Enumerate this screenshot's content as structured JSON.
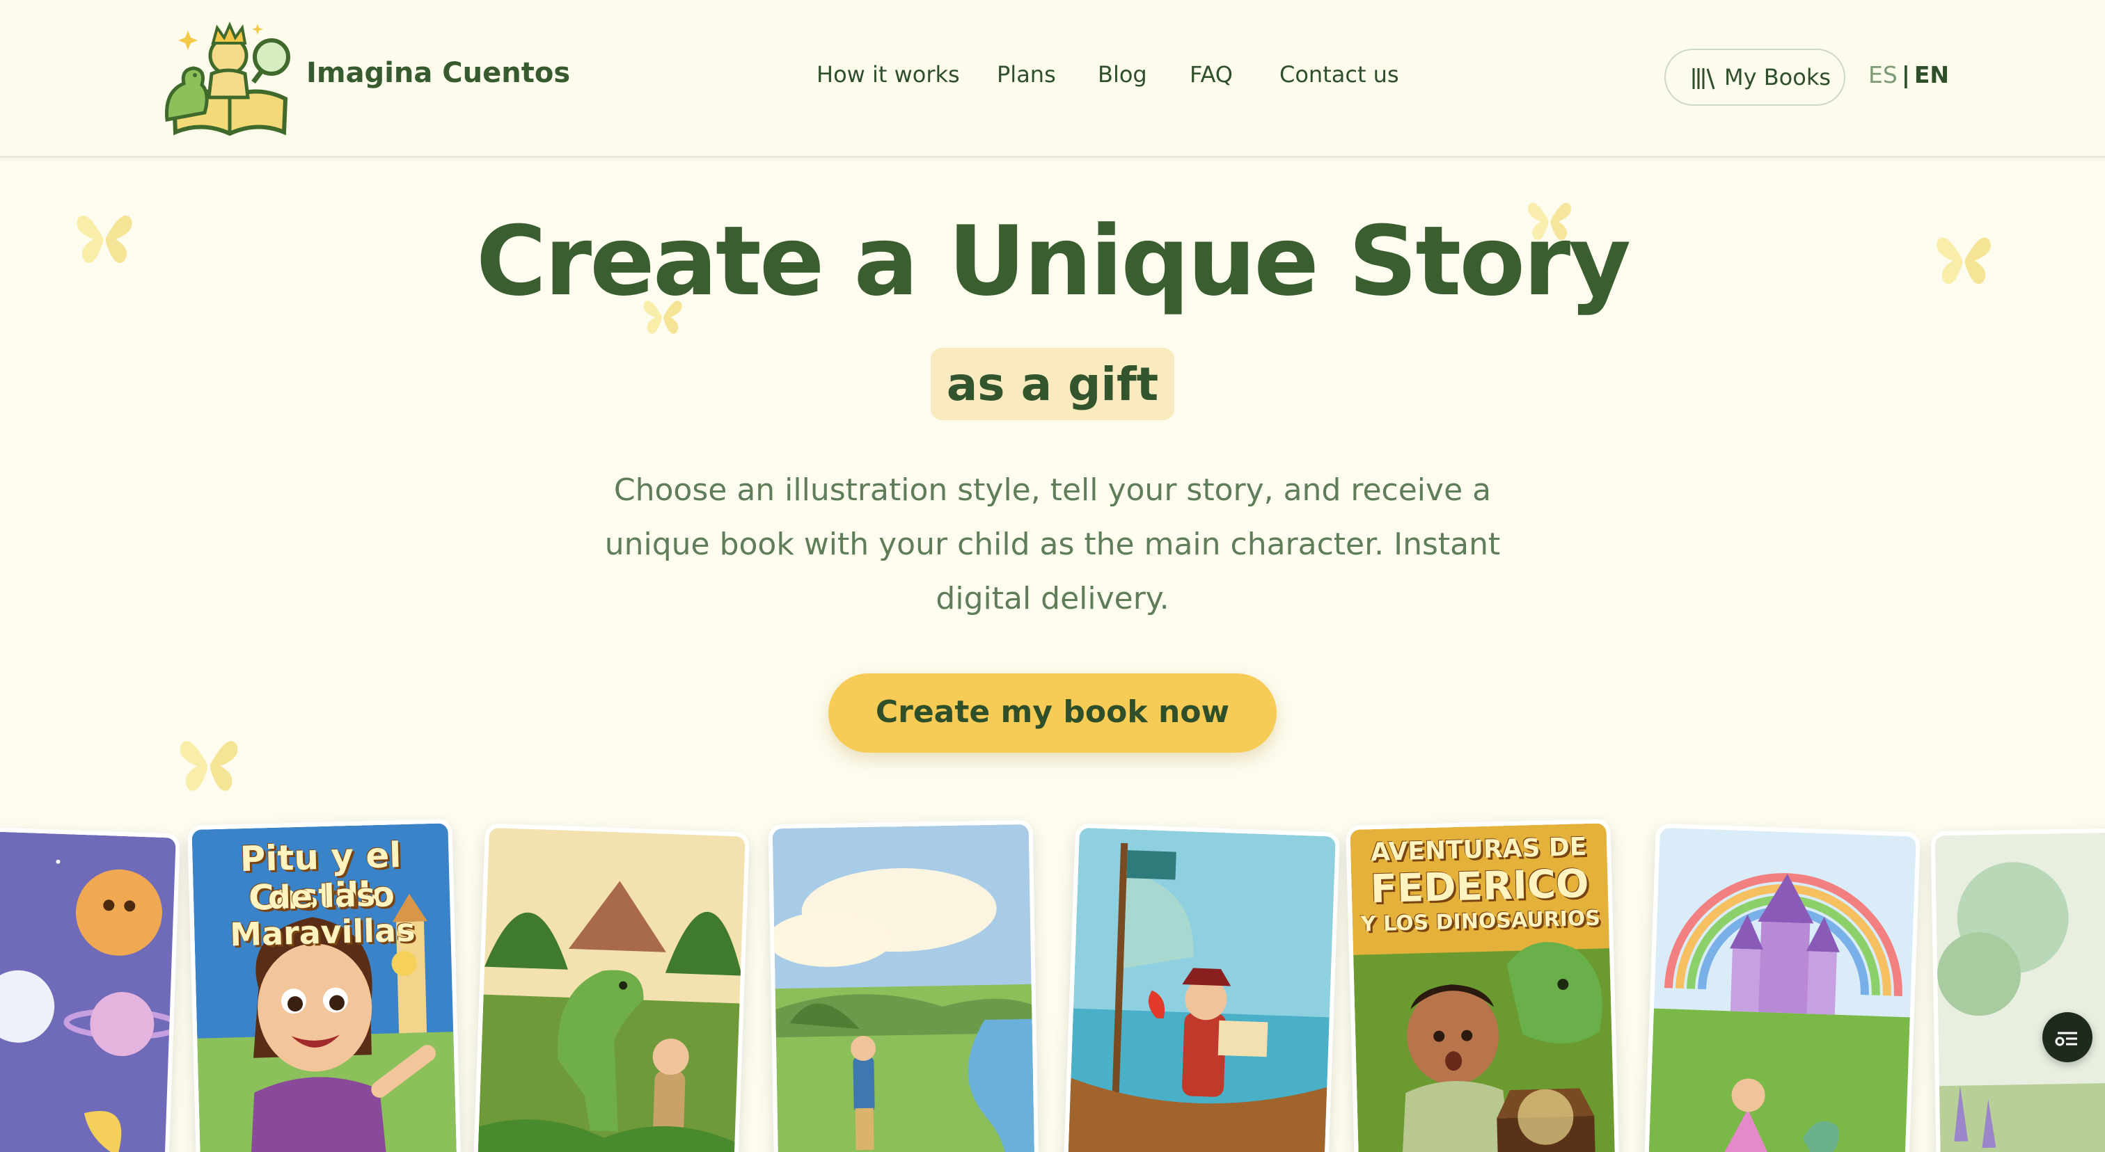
{
  "brand": {
    "name": "Imagina Cuentos",
    "logo": "dino-princess-book-logo"
  },
  "nav": {
    "items": [
      {
        "label": "How it works"
      },
      {
        "label": "Plans"
      },
      {
        "label": "Blog"
      },
      {
        "label": "FAQ"
      },
      {
        "label": "Contact us"
      }
    ]
  },
  "header": {
    "my_books_label": "My Books",
    "my_books_icon": "library-icon",
    "lang_es": "ES",
    "lang_sep": "|",
    "lang_en": "EN",
    "active_lang": "EN"
  },
  "hero": {
    "title": "Create a Unique Story",
    "highlight": "as a gift",
    "subtitle": "Choose an illustration style, tell your story, and receive a unique book with your child as the main character. Instant digital delivery.",
    "cta_label": "Create my book now"
  },
  "carousel": {
    "covers": [
      {
        "title": ""
      },
      {
        "title_line1": "Pitu y el Castillo",
        "title_line2": "de las Maravillas"
      },
      {
        "title": ""
      },
      {
        "title": ""
      },
      {
        "title": ""
      },
      {
        "title_line1": "AVENTURAS DE",
        "title_line2": "FEDERICO",
        "title_line3": "Y LOS DINOSAURIOS"
      },
      {
        "title": ""
      },
      {
        "title": ""
      }
    ]
  },
  "colors": {
    "background": "#fdfcef",
    "brand_green": "#3a5e30",
    "accent_yellow": "#f6cc56",
    "badge": "#faeac0"
  },
  "floating_button_icon": "menu-toggle-icon"
}
